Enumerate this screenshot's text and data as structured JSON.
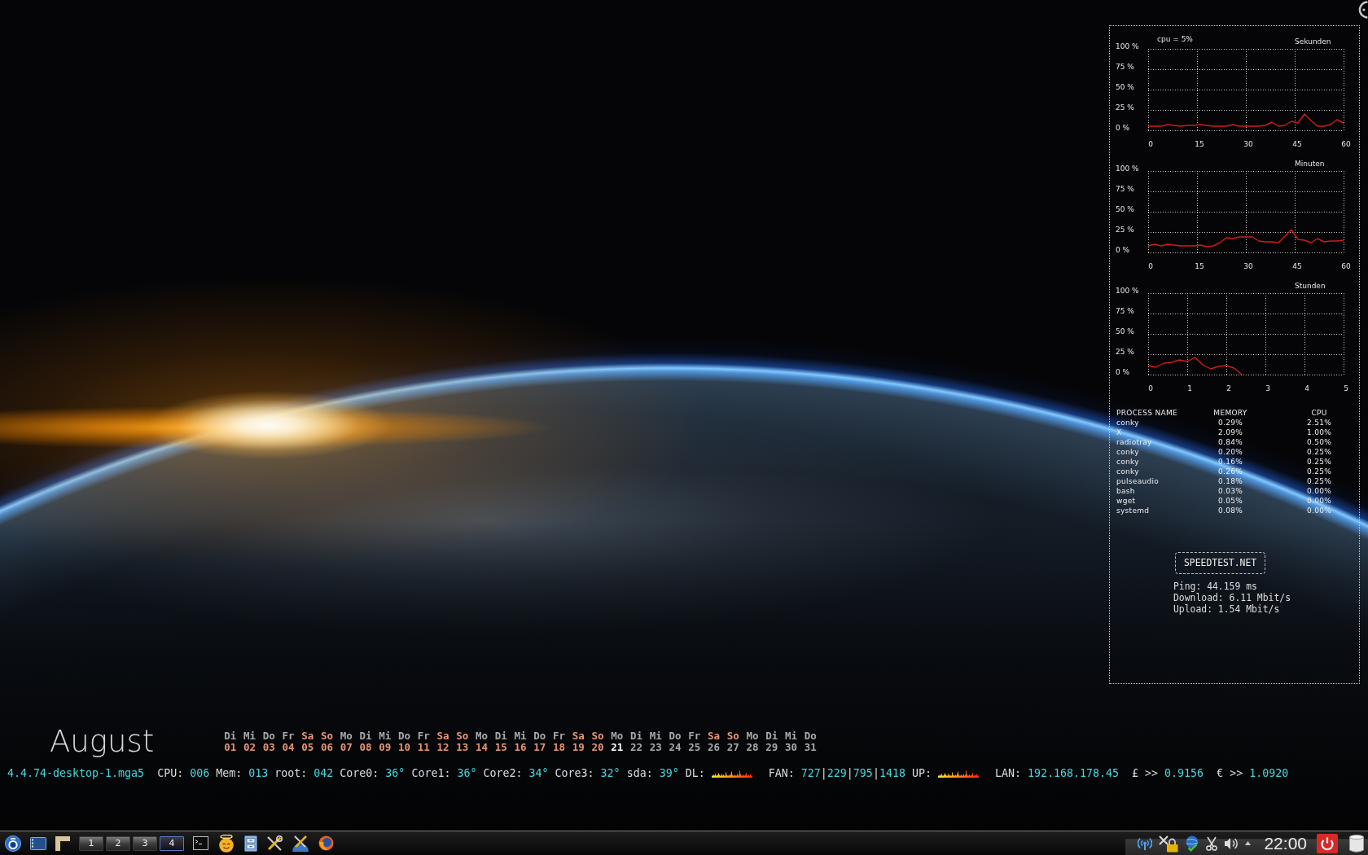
{
  "conky": {
    "graphs": [
      {
        "reading": "cpu = 5%",
        "chart_data": {
          "type": "line",
          "title": "Sekunden",
          "x": [
            0,
            2,
            4,
            6,
            8,
            10,
            12,
            14,
            16,
            18,
            20,
            22,
            24,
            26,
            28,
            30,
            32,
            34,
            36,
            38,
            40,
            42,
            44,
            46,
            48,
            50,
            52,
            54,
            56,
            58,
            60
          ],
          "series": [
            {
              "color": "#d01c1c",
              "values": [
                5,
                5,
                5,
                7,
                6,
                5,
                6,
                6,
                7,
                6,
                5,
                5,
                5,
                7,
                5,
                5,
                5,
                5,
                6,
                10,
                5,
                6,
                11,
                9,
                20,
                12,
                5,
                5,
                7,
                13,
                9
              ]
            }
          ],
          "xlim": [
            0,
            60
          ],
          "ylim": [
            0,
            100
          ],
          "xticks": [
            0,
            15,
            30,
            45,
            60
          ],
          "yticks": [
            {
              "value": 0,
              "label": "0 %"
            },
            {
              "value": 25,
              "label": "25 %"
            },
            {
              "value": 50,
              "label": "50 %"
            },
            {
              "value": 75,
              "label": "75 %"
            },
            {
              "value": 100,
              "label": "100 %"
            }
          ],
          "grid": true
        }
      },
      {
        "chart_data": {
          "type": "line",
          "title": "Minuten",
          "x": [
            0,
            2,
            4,
            6,
            8,
            10,
            12,
            14,
            16,
            18,
            20,
            22,
            24,
            26,
            28,
            30,
            32,
            34,
            36,
            38,
            40,
            42,
            44,
            46,
            48,
            50,
            52,
            54,
            56,
            58,
            60
          ],
          "series": [
            {
              "color": "#d01c1c",
              "values": [
                8,
                10,
                8,
                10,
                9,
                8,
                8,
                8,
                9,
                7,
                8,
                12,
                18,
                17,
                19,
                19,
                19,
                14,
                13,
                13,
                12,
                20,
                28,
                16,
                15,
                12,
                17,
                13,
                14,
                14,
                15
              ]
            }
          ],
          "xlim": [
            0,
            60
          ],
          "ylim": [
            0,
            100
          ],
          "xticks": [
            0,
            15,
            30,
            45,
            60
          ],
          "yticks": [
            {
              "value": 0,
              "label": "0 %"
            },
            {
              "value": 25,
              "label": "25 %"
            },
            {
              "value": 50,
              "label": "50 %"
            },
            {
              "value": 75,
              "label": "75 %"
            },
            {
              "value": 100,
              "label": "100 %"
            }
          ],
          "grid": true
        }
      },
      {
        "chart_data": {
          "type": "line",
          "title": "Stunden",
          "x": [
            0,
            0.2,
            0.4,
            0.6,
            0.8,
            1.0,
            1.2,
            1.4,
            1.6,
            1.8,
            2.0,
            2.2,
            2.4
          ],
          "series": [
            {
              "color": "#d01c1c",
              "values": [
                11,
                9,
                14,
                15,
                18,
                16,
                21,
                12,
                7,
                10,
                11,
                8,
                0
              ]
            }
          ],
          "xlim": [
            0,
            5
          ],
          "ylim": [
            0,
            100
          ],
          "xticks": [
            0,
            1,
            2,
            3,
            4,
            5
          ],
          "yticks": [
            {
              "value": 0,
              "label": "0 %"
            },
            {
              "value": 25,
              "label": "25 %"
            },
            {
              "value": 50,
              "label": "50 %"
            },
            {
              "value": 75,
              "label": "75 %"
            },
            {
              "value": 100,
              "label": "100 %"
            }
          ],
          "grid": true
        }
      }
    ],
    "processes": {
      "columns": [
        "PROCESS NAME",
        "MEMORY",
        "CPU"
      ],
      "rows": [
        [
          "conky",
          "0.29%",
          "2.51%"
        ],
        [
          "X",
          "2.09%",
          "1.00%"
        ],
        [
          "radiotray",
          "0.84%",
          "0.50%"
        ],
        [
          "conky",
          "0.20%",
          "0.25%"
        ],
        [
          "conky",
          "0.16%",
          "0.25%"
        ],
        [
          "conky",
          "0.26%",
          "0.25%"
        ],
        [
          "pulseaudio",
          "0.18%",
          "0.25%"
        ],
        [
          "bash",
          "0.03%",
          "0.00%"
        ],
        [
          "wget",
          "0.05%",
          "0.00%"
        ],
        [
          "systemd",
          "0.08%",
          "0.00%"
        ]
      ]
    },
    "speedtest": {
      "title": "SPEEDTEST.NET",
      "lines": [
        "Ping: 44.159 ms",
        "Download: 6.11 Mbit/s",
        "Upload: 1.54 Mbit/s"
      ]
    }
  },
  "calendar": {
    "month": "August",
    "days": [
      {
        "weekday": "Di",
        "day": "01",
        "weekend": false,
        "past": true,
        "today": false
      },
      {
        "weekday": "Mi",
        "day": "02",
        "weekend": false,
        "past": true,
        "today": false
      },
      {
        "weekday": "Do",
        "day": "03",
        "weekend": false,
        "past": true,
        "today": false
      },
      {
        "weekday": "Fr",
        "day": "04",
        "weekend": false,
        "past": true,
        "today": false
      },
      {
        "weekday": "Sa",
        "day": "05",
        "weekend": true,
        "past": true,
        "today": false
      },
      {
        "weekday": "So",
        "day": "06",
        "weekend": true,
        "past": true,
        "today": false
      },
      {
        "weekday": "Mo",
        "day": "07",
        "weekend": false,
        "past": true,
        "today": false
      },
      {
        "weekday": "Di",
        "day": "08",
        "weekend": false,
        "past": true,
        "today": false
      },
      {
        "weekday": "Mi",
        "day": "09",
        "weekend": false,
        "past": true,
        "today": false
      },
      {
        "weekday": "Do",
        "day": "10",
        "weekend": false,
        "past": true,
        "today": false
      },
      {
        "weekday": "Fr",
        "day": "11",
        "weekend": false,
        "past": true,
        "today": false
      },
      {
        "weekday": "Sa",
        "day": "12",
        "weekend": true,
        "past": true,
        "today": false
      },
      {
        "weekday": "So",
        "day": "13",
        "weekend": true,
        "past": true,
        "today": false
      },
      {
        "weekday": "Mo",
        "day": "14",
        "weekend": false,
        "past": true,
        "today": false
      },
      {
        "weekday": "Di",
        "day": "15",
        "weekend": false,
        "past": true,
        "today": false
      },
      {
        "weekday": "Mi",
        "day": "16",
        "weekend": false,
        "past": true,
        "today": false
      },
      {
        "weekday": "Do",
        "day": "17",
        "weekend": false,
        "past": true,
        "today": false
      },
      {
        "weekday": "Fr",
        "day": "18",
        "weekend": false,
        "past": true,
        "today": false
      },
      {
        "weekday": "Sa",
        "day": "19",
        "weekend": true,
        "past": true,
        "today": false
      },
      {
        "weekday": "So",
        "day": "20",
        "weekend": true,
        "past": true,
        "today": false
      },
      {
        "weekday": "Mo",
        "day": "21",
        "weekend": false,
        "past": false,
        "today": true
      },
      {
        "weekday": "Di",
        "day": "22",
        "weekend": false,
        "past": false,
        "today": false
      },
      {
        "weekday": "Mi",
        "day": "23",
        "weekend": false,
        "past": false,
        "today": false
      },
      {
        "weekday": "Do",
        "day": "24",
        "weekend": false,
        "past": false,
        "today": false
      },
      {
        "weekday": "Fr",
        "day": "25",
        "weekend": false,
        "past": false,
        "today": false
      },
      {
        "weekday": "Sa",
        "day": "26",
        "weekend": true,
        "past": false,
        "today": false
      },
      {
        "weekday": "So",
        "day": "27",
        "weekend": true,
        "past": false,
        "today": false
      },
      {
        "weekday": "Mo",
        "day": "28",
        "weekend": false,
        "past": false,
        "today": false
      },
      {
        "weekday": "Di",
        "day": "29",
        "weekend": false,
        "past": false,
        "today": false
      },
      {
        "weekday": "Mi",
        "day": "30",
        "weekend": false,
        "past": false,
        "today": false
      },
      {
        "weekday": "Do",
        "day": "31",
        "weekend": false,
        "past": false,
        "today": false
      }
    ]
  },
  "status_line": {
    "kernel": "4.4.74-desktop-1.mga5",
    "items": [
      {
        "kind": "text",
        "label": "CPU:",
        "value": "006"
      },
      {
        "kind": "text",
        "label": "Mem:",
        "value": "013"
      },
      {
        "kind": "text",
        "label": "root:",
        "value": "042"
      },
      {
        "kind": "text",
        "label": "Core0:",
        "value": "36°"
      },
      {
        "kind": "text",
        "label": "Core1:",
        "value": "36°"
      },
      {
        "kind": "text",
        "label": "Core2:",
        "value": "34°"
      },
      {
        "kind": "text",
        "label": "Core3:",
        "value": "32°"
      },
      {
        "kind": "text",
        "label": "sda:",
        "value": "39°"
      },
      {
        "kind": "graph",
        "label": "DL:"
      },
      {
        "kind": "list",
        "label": "FAN:",
        "values": [
          "727",
          "229",
          "795",
          "1418"
        ],
        "separator": "|"
      },
      {
        "kind": "graph",
        "label": "UP:"
      },
      {
        "kind": "text",
        "label": "LAN:",
        "value": "192.168.178.45"
      },
      {
        "kind": "rate",
        "label": "£ >>",
        "value": "0.9156"
      },
      {
        "kind": "rate",
        "label": "€ >>",
        "value": "1.0920"
      }
    ]
  },
  "taskbar": {
    "pager": [
      {
        "label": "1",
        "selected": false
      },
      {
        "label": "2",
        "selected": false
      },
      {
        "label": "3",
        "selected": false
      },
      {
        "label": "4",
        "selected": true
      }
    ],
    "clock": "22:00"
  }
}
